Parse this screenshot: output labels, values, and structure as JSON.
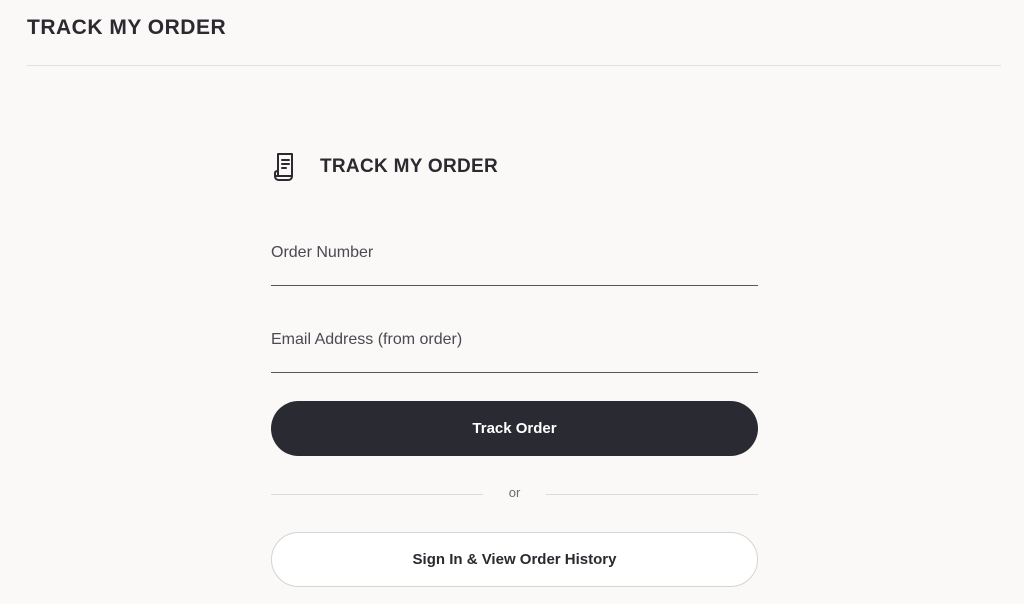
{
  "page": {
    "title": "TRACK MY ORDER"
  },
  "form": {
    "icon": "receipt-icon",
    "title": "TRACK MY ORDER",
    "order_number_placeholder": "Order Number",
    "order_number_value": "",
    "email_placeholder": "Email Address (from order)",
    "email_value": "",
    "track_button_label": "Track Order",
    "or_label": "or",
    "signin_button_label": "Sign In & View Order History"
  },
  "colors": {
    "background": "#faf9f7",
    "primary_button": "#2a2a33",
    "text": "#2a2a30"
  }
}
